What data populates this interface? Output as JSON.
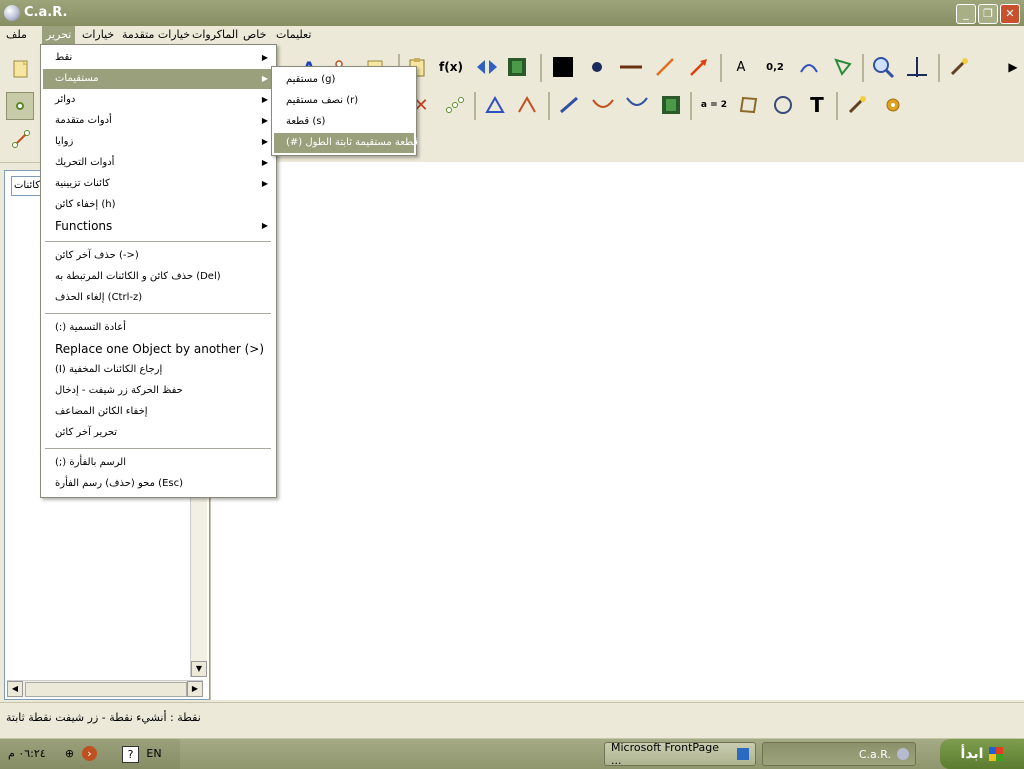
{
  "window": {
    "title": "C.a.R."
  },
  "menubar": {
    "file": "ملف",
    "edit": "تحرير",
    "options": "خيارات",
    "advanced_options": "خيارات متقدمة",
    "macros": "الماكروات",
    "special": "خاص",
    "help": "تعليمات"
  },
  "edit_menu": {
    "items": [
      {
        "label": "نقط"
      },
      {
        "label": "مستقيمات"
      },
      {
        "label": "دوائر"
      },
      {
        "label": "أدوات متقدمة"
      },
      {
        "label": "زوايا"
      },
      {
        "label": "أدوات التحريك"
      },
      {
        "label": "كائنات تزيينية"
      },
      {
        "label": "إخفاء كائن (h)"
      },
      {
        "label": "Functions"
      },
      {
        "label": "حذف آخر كائن     (->)"
      },
      {
        "label": "حذف كائن و الكائنات المرتبطة به (Del)"
      },
      {
        "label": "إلغاء الحذف    (Ctrl-z)"
      },
      {
        "label": "(:) أعادة التسمية"
      },
      {
        "label": "Replace one Object by another (>)"
      },
      {
        "label": "(I) إرجاع الكائنات المخفية"
      },
      {
        "label": "حفظ الحركة زر شيفت - إدخال"
      },
      {
        "label": "إخفاء الكائن المضاعف"
      },
      {
        "label": "تحرير آخر كائن"
      },
      {
        "label": "(;) الرسم بالفأرة"
      },
      {
        "label": "محو (حذف) رسم الفأرة     (Esc)"
      }
    ]
  },
  "lines_submenu": {
    "items": [
      {
        "label": "مستقيم (g)"
      },
      {
        "label": "نصف مستقيم (r)"
      },
      {
        "label": "قطعة (s)"
      },
      {
        "label": "(#) قطعة مستقيمة ثابتة الطول"
      }
    ]
  },
  "toolbar": {
    "fx_label": "f(x)",
    "coord_label": "0,2",
    "eq_label": "a = 2",
    "text_tool": "T",
    "point_label": "A"
  },
  "left_panel": {
    "input_value": "كائنات"
  },
  "status": {
    "text": "نقطة : أنشيء نقطة - زر شيفت نقطة ثابتة"
  },
  "taskbar": {
    "start": "ابدأ",
    "task_car": "C.a.R.",
    "task_frontpage": "Microsoft FrontPage ...",
    "clock": "٠٦:٢٤ م",
    "lang": "EN"
  },
  "colors": {
    "menu_highlight": "#9aa07c",
    "titlebar": "#8f966a",
    "toolbar_bg": "#ece9d8"
  }
}
